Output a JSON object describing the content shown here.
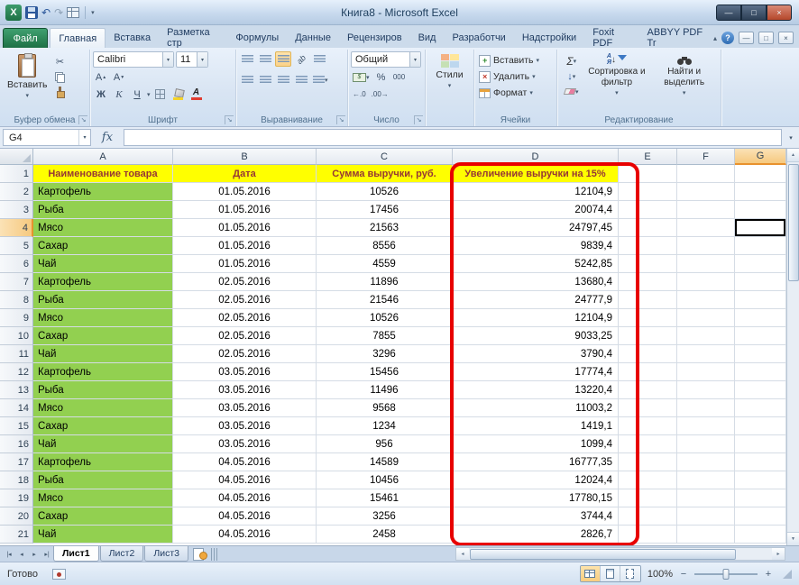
{
  "window": {
    "title": "Книга8  -  Microsoft Excel"
  },
  "icons": {
    "excel_logo": "X",
    "undo": "↶",
    "redo": "↷",
    "dropdown": "▾",
    "cut": "✂",
    "minimize": "—",
    "maximize": "□",
    "close": "×",
    "help": "?",
    "collapse_ribbon": "▴",
    "launcher": "↘",
    "fill_down": "↓",
    "money": "$",
    "percent": "%",
    "dec_inc": "←.0",
    "dec_dec": ".00→",
    "font_up": "А",
    "font_down": "А",
    "sort_a": "А",
    "sort_z": "Я",
    "sort_arrow": "↓",
    "scroll_up": "▲",
    "scroll_down": "▼",
    "scroll_left": "◂",
    "scroll_right": "▸",
    "tab_nav": [
      "|◂",
      "◂",
      "▸",
      "▸|"
    ],
    "zoom_out": "−",
    "zoom_in": "+"
  },
  "ribbon_tabs": {
    "file": "Файл",
    "items": [
      {
        "label": "Главная",
        "active": true
      },
      {
        "label": "Вставка"
      },
      {
        "label": "Разметка стр"
      },
      {
        "label": "Формулы"
      },
      {
        "label": "Данные"
      },
      {
        "label": "Рецензиров"
      },
      {
        "label": "Вид"
      },
      {
        "label": "Разработчи"
      },
      {
        "label": "Надстройки"
      },
      {
        "label": "Foxit PDF"
      },
      {
        "label": "ABBYY PDF Tr"
      }
    ]
  },
  "ribbon": {
    "clipboard": {
      "paste": "Вставить",
      "label": "Буфер обмена"
    },
    "font": {
      "family": "Calibri",
      "size": "11",
      "bold": "Ж",
      "italic": "К",
      "underline": "Ч",
      "label": "Шрифт"
    },
    "alignment": {
      "orient": "ab",
      "label": "Выравнивание"
    },
    "number": {
      "format": "Общий",
      "thousands": "000",
      "label": "Число"
    },
    "styles": {
      "button": "Стили"
    },
    "cells": {
      "insert": "Вставить",
      "delete": "Удалить",
      "format": "Формат",
      "label": "Ячейки"
    },
    "editing": {
      "sum": "Σ",
      "sort": "Сортировка и фильтр",
      "find": "Найти и выделить",
      "label": "Редактирование"
    }
  },
  "formula_bar": {
    "name_box": "G4",
    "fx": "fx",
    "formula": ""
  },
  "sheet": {
    "col_letters": [
      "A",
      "B",
      "C",
      "D",
      "E",
      "F",
      "G"
    ],
    "selected_col": "G",
    "selected_row": 4,
    "active_cell": "G4",
    "header_row": [
      "Наименование товара",
      "Дата",
      "Сумма выручки, руб.",
      "Увеличение выручки на 15%"
    ],
    "rows": [
      {
        "n": 2,
        "product": "Картофель",
        "date": "01.05.2016",
        "revenue": "10526",
        "increased": "12104,9"
      },
      {
        "n": 3,
        "product": "Рыба",
        "date": "01.05.2016",
        "revenue": "17456",
        "increased": "20074,4"
      },
      {
        "n": 4,
        "product": "Мясо",
        "date": "01.05.2016",
        "revenue": "21563",
        "increased": "24797,45"
      },
      {
        "n": 5,
        "product": "Сахар",
        "date": "01.05.2016",
        "revenue": "8556",
        "increased": "9839,4"
      },
      {
        "n": 6,
        "product": "Чай",
        "date": "01.05.2016",
        "revenue": "4559",
        "increased": "5242,85"
      },
      {
        "n": 7,
        "product": "Картофель",
        "date": "02.05.2016",
        "revenue": "11896",
        "increased": "13680,4"
      },
      {
        "n": 8,
        "product": "Рыба",
        "date": "02.05.2016",
        "revenue": "21546",
        "increased": "24777,9"
      },
      {
        "n": 9,
        "product": "Мясо",
        "date": "02.05.2016",
        "revenue": "10526",
        "increased": "12104,9"
      },
      {
        "n": 10,
        "product": "Сахар",
        "date": "02.05.2016",
        "revenue": "7855",
        "increased": "9033,25"
      },
      {
        "n": 11,
        "product": "Чай",
        "date": "02.05.2016",
        "revenue": "3296",
        "increased": "3790,4"
      },
      {
        "n": 12,
        "product": "Картофель",
        "date": "03.05.2016",
        "revenue": "15456",
        "increased": "17774,4"
      },
      {
        "n": 13,
        "product": "Рыба",
        "date": "03.05.2016",
        "revenue": "11496",
        "increased": "13220,4"
      },
      {
        "n": 14,
        "product": "Мясо",
        "date": "03.05.2016",
        "revenue": "9568",
        "increased": "11003,2"
      },
      {
        "n": 15,
        "product": "Сахар",
        "date": "03.05.2016",
        "revenue": "1234",
        "increased": "1419,1"
      },
      {
        "n": 16,
        "product": "Чай",
        "date": "03.05.2016",
        "revenue": "956",
        "increased": "1099,4"
      },
      {
        "n": 17,
        "product": "Картофель",
        "date": "04.05.2016",
        "revenue": "14589",
        "increased": "16777,35"
      },
      {
        "n": 18,
        "product": "Рыба",
        "date": "04.05.2016",
        "revenue": "10456",
        "increased": "12024,4"
      },
      {
        "n": 19,
        "product": "Мясо",
        "date": "04.05.2016",
        "revenue": "15461",
        "increased": "17780,15"
      },
      {
        "n": 20,
        "product": "Сахар",
        "date": "04.05.2016",
        "revenue": "3256",
        "increased": "3744,4"
      },
      {
        "n": 21,
        "product": "Чай",
        "date": "04.05.2016",
        "revenue": "2458",
        "increased": "2826,7"
      }
    ]
  },
  "sheet_tabs": {
    "tabs": [
      "Лист1",
      "Лист2",
      "Лист3"
    ],
    "active": "Лист1"
  },
  "status_bar": {
    "ready": "Готово",
    "zoom": "100%"
  },
  "colors": {
    "header_fill": "#ffff00",
    "header_text": "#953735",
    "product_fill": "#92d050",
    "annotation_red": "#e80000",
    "file_tab_green": "#1e7145",
    "selection_border": "#000000",
    "selected_header": "#f6c97f"
  }
}
